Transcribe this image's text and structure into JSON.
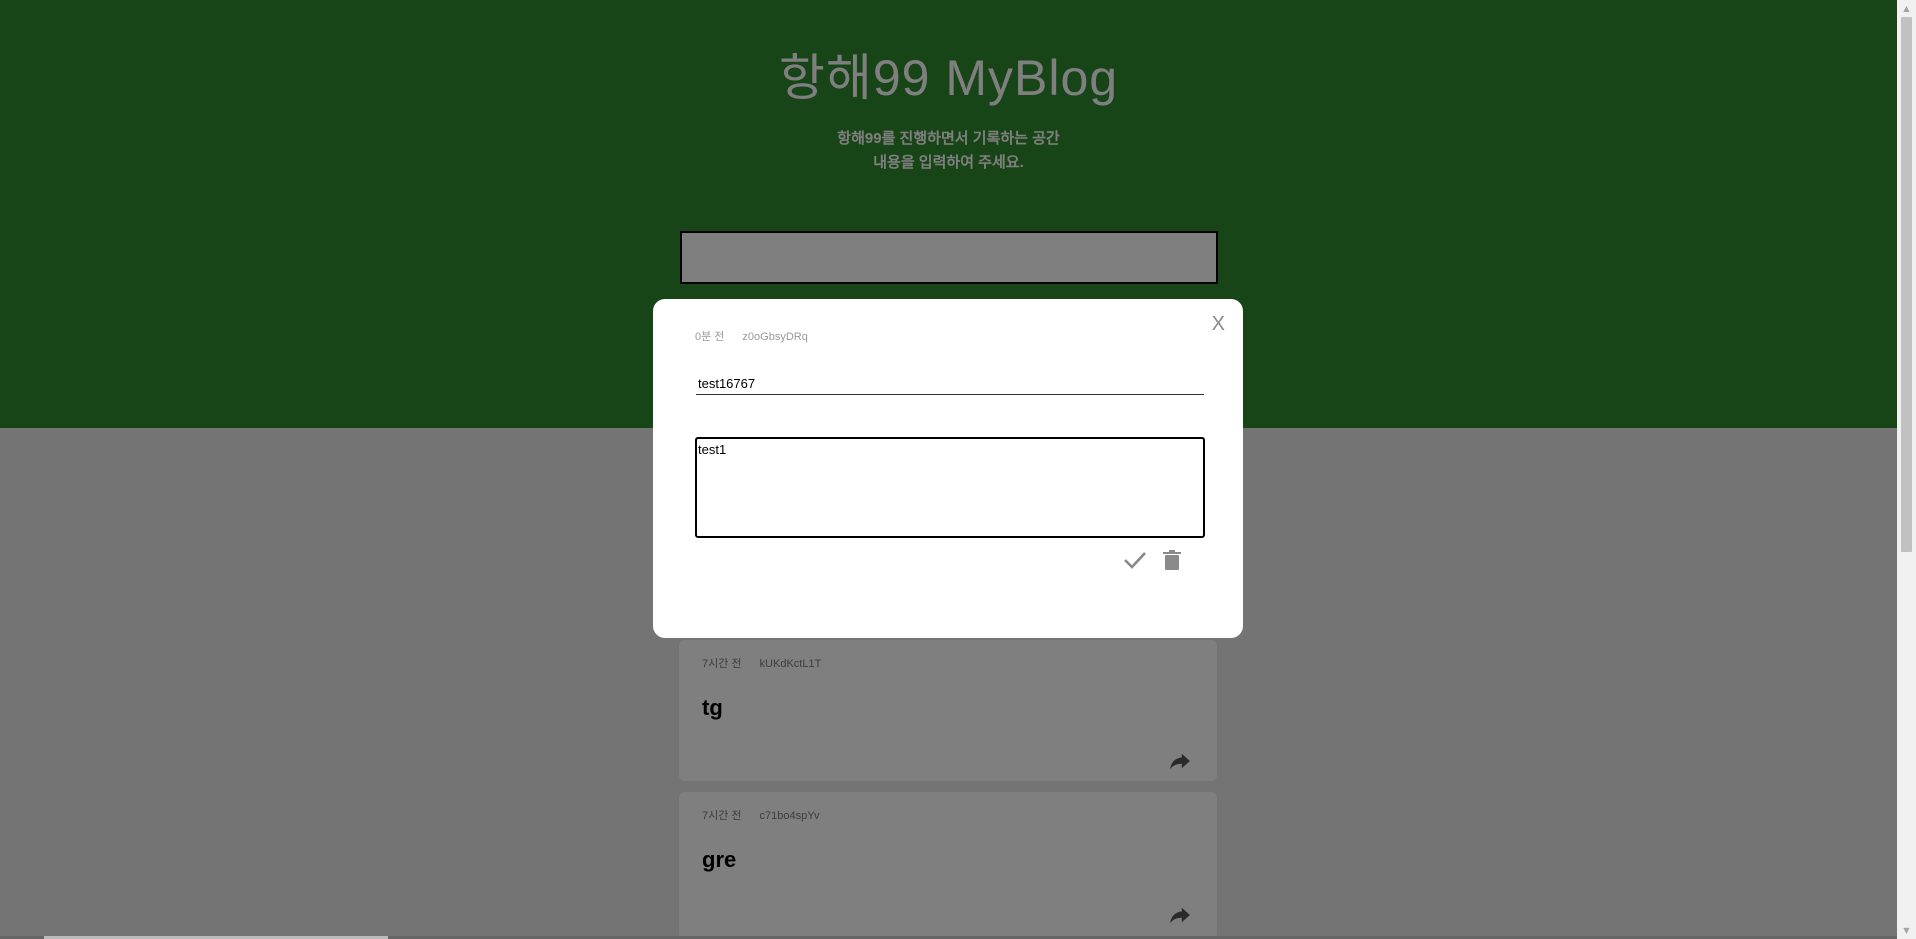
{
  "header": {
    "site_title": "항해99 MyBlog",
    "subtitle_line1": "항해99를 진행하면서 기록하는 공간",
    "subtitle_line2": "내용을 입력하여 주세요.",
    "bg_color": "#2e8b2e"
  },
  "main_input": {
    "value": ""
  },
  "posts": [
    {
      "time": "7시간 전",
      "id": "kUKdKctL1T",
      "title": "tg"
    },
    {
      "time": "7시간 전",
      "id": "c71bo4spYv",
      "title": "gre"
    }
  ],
  "modal": {
    "close_label": "X",
    "time": "0분 전",
    "id": "z0oGbsyDRq",
    "title_value": "test16767",
    "content_value": "test1",
    "icons": {
      "confirm": "check-icon",
      "delete": "trash-icon",
      "share": "share-icon"
    }
  }
}
